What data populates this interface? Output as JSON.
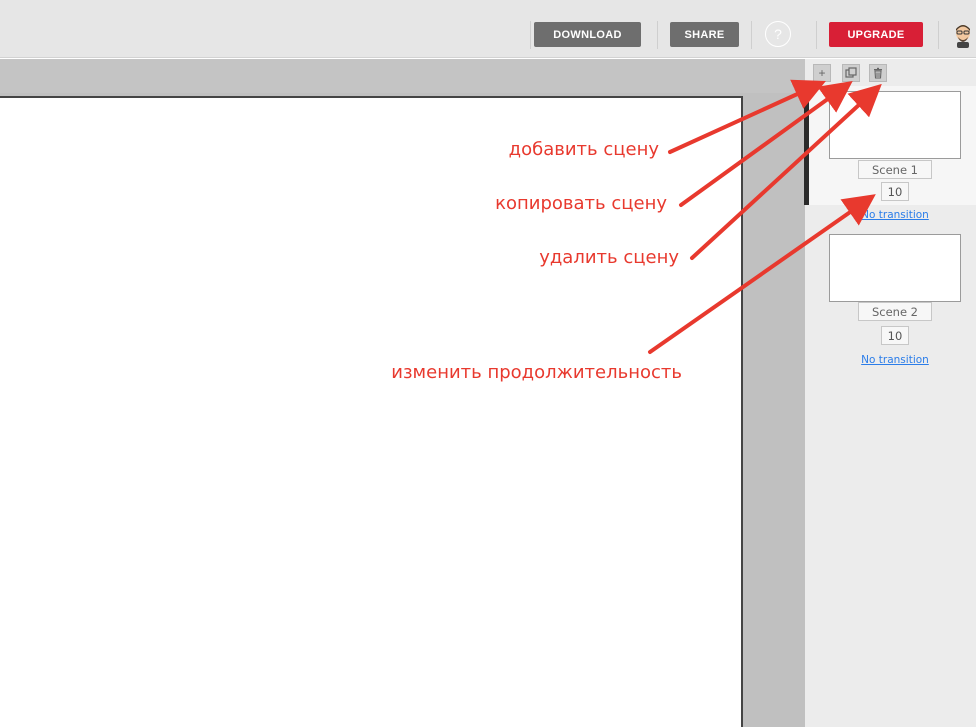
{
  "header": {
    "download_label": "DOWNLOAD",
    "share_label": "SHARE",
    "help_label": "?",
    "upgrade_label": "UPGRADE",
    "avatar_icon": "user-avatar-icon"
  },
  "scene_toolbar": {
    "add_icon": "plus-icon",
    "add_glyph": "+",
    "copy_icon": "copy-icon",
    "delete_icon": "trash-icon"
  },
  "scenes": [
    {
      "label": "Scene 1",
      "duration": "10",
      "transition": "No transition",
      "active": true
    },
    {
      "label": "Scene 2",
      "duration": "10",
      "transition": "No transition",
      "active": false
    }
  ],
  "annotations": {
    "add_scene": "добавить сцену",
    "copy_scene": "копировать сцену",
    "delete_scene": "удалить сцену",
    "change_duration": "изменить продолжительность"
  },
  "colors": {
    "upgrade": "#d81f36",
    "annotation": "#e8392e",
    "link": "#2b7de9"
  }
}
